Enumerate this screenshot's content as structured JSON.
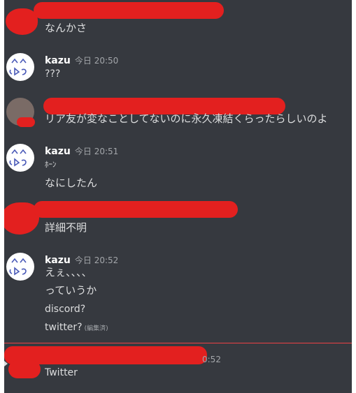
{
  "messages": [
    {
      "lines": [
        "なんかさ"
      ]
    },
    {
      "author": "kazu",
      "timestamp": "今日 20:50",
      "lines": [
        "???"
      ]
    },
    {
      "lines": [
        "リア友が変なことしてないのに永久凍結くらったらしいのよ"
      ]
    },
    {
      "author": "kazu",
      "timestamp": "今日 20:51",
      "lines": [
        "ﾎｰﾝ",
        "なにしたん"
      ]
    },
    {
      "lines": [
        "詳細不明"
      ]
    },
    {
      "author": "kazu",
      "timestamp": "今日 20:52",
      "lines": [
        "えぇ、、、、",
        "っていうか",
        "discord?",
        "twitter?"
      ],
      "edited": "(編集済)"
    },
    {
      "timestamp_partial": "0:52",
      "lines": [
        "Twitter"
      ]
    }
  ],
  "colors": {
    "background": "#36393f",
    "redaction": "#e3201f",
    "new_message_divider": "#ed4245"
  },
  "icons": [
    "kazu-avatar-face-icon"
  ]
}
